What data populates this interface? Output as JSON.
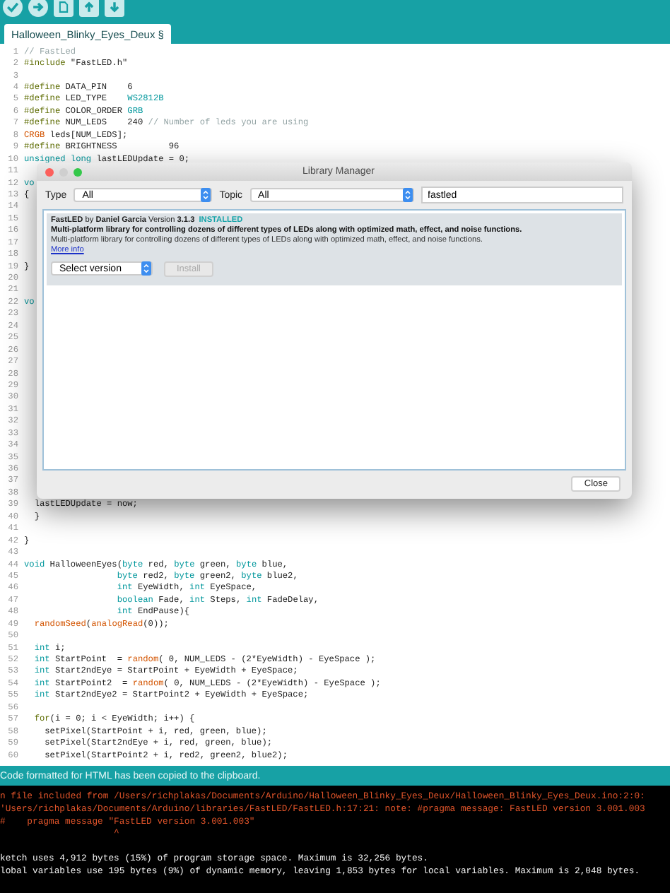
{
  "toolbar": {
    "buttons": [
      {
        "kind": "verify"
      },
      {
        "kind": "upload"
      },
      {
        "kind": "new"
      },
      {
        "kind": "open"
      },
      {
        "kind": "save"
      }
    ]
  },
  "tabs": [
    {
      "label": "Halloween_Blinky_Eyes_Deux §",
      "selected": true
    }
  ],
  "editor": {
    "lines": [
      {
        "number": "1",
        "segments": [
          {
            "text": "// FastLed",
            "kind": "comment"
          }
        ]
      },
      {
        "number": "2",
        "segments": [
          {
            "text": "#include",
            "kind": "directive"
          },
          {
            "text": " \"FastLED.h\"",
            "kind": "plain"
          }
        ]
      },
      {
        "number": "3"
      },
      {
        "number": "4",
        "segments": [
          {
            "text": "#define",
            "kind": "directive"
          },
          {
            "text": " DATA_PIN    6",
            "kind": "plain"
          }
        ]
      },
      {
        "number": "5",
        "segments": [
          {
            "text": "#define",
            "kind": "directive"
          },
          {
            "text": " LED_TYPE    ",
            "kind": "plain"
          },
          {
            "text": "WS2812B",
            "kind": "keyword"
          }
        ]
      },
      {
        "number": "6",
        "segments": [
          {
            "text": "#define",
            "kind": "directive"
          },
          {
            "text": " COLOR_ORDER ",
            "kind": "plain"
          },
          {
            "text": "GRB",
            "kind": "keyword"
          }
        ]
      },
      {
        "number": "7",
        "segments": [
          {
            "text": "#define",
            "kind": "directive"
          },
          {
            "text": " NUM_LEDS    240 ",
            "kind": "plain"
          },
          {
            "text": "// Number of leds you are using",
            "kind": "comment"
          }
        ]
      },
      {
        "number": "8",
        "segments": [
          {
            "text": "CRGB",
            "kind": "function"
          },
          {
            "text": " leds[NUM_LEDS];",
            "kind": "plain"
          }
        ]
      },
      {
        "number": "9",
        "segments": [
          {
            "text": "#define",
            "kind": "directive"
          },
          {
            "text": " BRIGHTNESS          96",
            "kind": "plain"
          }
        ]
      },
      {
        "number": "10",
        "segments": [
          {
            "text": "unsigned long",
            "kind": "keyword"
          },
          {
            "text": " lastLEDUpdate = 0;",
            "kind": "plain"
          }
        ]
      },
      {
        "number": "11"
      },
      {
        "number": "12",
        "segments": [
          {
            "text": "vo",
            "kind": "keyword"
          }
        ]
      },
      {
        "number": "13",
        "segments": [
          {
            "text": "{",
            "kind": "plain"
          }
        ]
      },
      {
        "number": "14"
      },
      {
        "number": "15"
      },
      {
        "number": "16"
      },
      {
        "number": "17"
      },
      {
        "number": "18"
      },
      {
        "number": "19",
        "segments": [
          {
            "text": "}",
            "kind": "plain"
          }
        ]
      },
      {
        "number": "20"
      },
      {
        "number": "21"
      },
      {
        "number": "22",
        "segments": [
          {
            "text": "vo",
            "kind": "keyword"
          }
        ]
      },
      {
        "number": "23"
      },
      {
        "number": "24"
      },
      {
        "number": "25"
      },
      {
        "number": "26"
      },
      {
        "number": "27"
      },
      {
        "number": "28"
      },
      {
        "number": "29"
      },
      {
        "number": "30"
      },
      {
        "number": "31"
      },
      {
        "number": "32"
      },
      {
        "number": "33"
      },
      {
        "number": "34"
      },
      {
        "number": "35"
      },
      {
        "number": "36"
      },
      {
        "number": "37"
      },
      {
        "number": "38"
      },
      {
        "number": "39",
        "segments": [
          {
            "text": "  lastLEDUpdate = now;",
            "kind": "plain"
          }
        ]
      },
      {
        "number": "40",
        "segments": [
          {
            "text": "  }",
            "kind": "plain"
          }
        ]
      },
      {
        "number": "41"
      },
      {
        "number": "42",
        "segments": [
          {
            "text": "}",
            "kind": "plain"
          }
        ]
      },
      {
        "number": "43"
      },
      {
        "number": "44",
        "segments": [
          {
            "text": "void",
            "kind": "keyword"
          },
          {
            "text": " HalloweenEyes(",
            "kind": "plain"
          },
          {
            "text": "byte",
            "kind": "keyword"
          },
          {
            "text": " red, ",
            "kind": "plain"
          },
          {
            "text": "byte",
            "kind": "keyword"
          },
          {
            "text": " green, ",
            "kind": "plain"
          },
          {
            "text": "byte",
            "kind": "keyword"
          },
          {
            "text": " blue,",
            "kind": "plain"
          }
        ]
      },
      {
        "number": "45",
        "segments": [
          {
            "text": "                  byte",
            "kind": "keyword"
          },
          {
            "text": " red2, ",
            "kind": "plain"
          },
          {
            "text": "byte",
            "kind": "keyword"
          },
          {
            "text": " green2, ",
            "kind": "plain"
          },
          {
            "text": "byte",
            "kind": "keyword"
          },
          {
            "text": " blue2,",
            "kind": "plain"
          }
        ]
      },
      {
        "number": "46",
        "segments": [
          {
            "text": "                  int",
            "kind": "keyword"
          },
          {
            "text": " EyeWidth, ",
            "kind": "plain"
          },
          {
            "text": "int",
            "kind": "keyword"
          },
          {
            "text": " EyeSpace,",
            "kind": "plain"
          }
        ]
      },
      {
        "number": "47",
        "segments": [
          {
            "text": "                  boolean",
            "kind": "keyword"
          },
          {
            "text": " Fade, ",
            "kind": "plain"
          },
          {
            "text": "int",
            "kind": "keyword"
          },
          {
            "text": " Steps, ",
            "kind": "plain"
          },
          {
            "text": "int",
            "kind": "keyword"
          },
          {
            "text": " FadeDelay,",
            "kind": "plain"
          }
        ]
      },
      {
        "number": "48",
        "segments": [
          {
            "text": "                  int",
            "kind": "keyword"
          },
          {
            "text": " EndPause){",
            "kind": "plain"
          }
        ]
      },
      {
        "number": "49",
        "segments": [
          {
            "text": "  randomSeed",
            "kind": "function"
          },
          {
            "text": "(",
            "kind": "plain"
          },
          {
            "text": "analogRead",
            "kind": "function"
          },
          {
            "text": "(0));",
            "kind": "plain"
          }
        ]
      },
      {
        "number": "50"
      },
      {
        "number": "51",
        "segments": [
          {
            "text": "  int",
            "kind": "keyword"
          },
          {
            "text": " i;",
            "kind": "plain"
          }
        ]
      },
      {
        "number": "52",
        "segments": [
          {
            "text": "  int",
            "kind": "keyword"
          },
          {
            "text": " StartPoint  = ",
            "kind": "plain"
          },
          {
            "text": "random",
            "kind": "function"
          },
          {
            "text": "( 0, NUM_LEDS - (2*EyeWidth) - EyeSpace );",
            "kind": "plain"
          }
        ]
      },
      {
        "number": "53",
        "segments": [
          {
            "text": "  int",
            "kind": "keyword"
          },
          {
            "text": " Start2ndEye = StartPoint + EyeWidth + EyeSpace;",
            "kind": "plain"
          }
        ]
      },
      {
        "number": "54",
        "segments": [
          {
            "text": "  int",
            "kind": "keyword"
          },
          {
            "text": " StartPoint2  = ",
            "kind": "plain"
          },
          {
            "text": "random",
            "kind": "function"
          },
          {
            "text": "( 0, NUM_LEDS - (2*EyeWidth) - EyeSpace );",
            "kind": "plain"
          }
        ]
      },
      {
        "number": "55",
        "segments": [
          {
            "text": "  int",
            "kind": "keyword"
          },
          {
            "text": " Start2ndEye2 = StartPoint2 + EyeWidth + EyeSpace;",
            "kind": "plain"
          }
        ]
      },
      {
        "number": "56"
      },
      {
        "number": "57",
        "segments": [
          {
            "text": "  for",
            "kind": "directive"
          },
          {
            "text": "(i = 0; i < EyeWidth; i++) {",
            "kind": "plain"
          }
        ]
      },
      {
        "number": "58",
        "segments": [
          {
            "text": "    setPixel(StartPoint + i, red, green, blue);",
            "kind": "plain"
          }
        ]
      },
      {
        "number": "59",
        "segments": [
          {
            "text": "    setPixel(Start2ndEye + i, red, green, blue);",
            "kind": "plain"
          }
        ]
      },
      {
        "number": "60",
        "segments": [
          {
            "text": "    setPixel(StartPoint2 + i, red2, green2, blue2);",
            "kind": "plain"
          }
        ]
      }
    ]
  },
  "dialog": {
    "title": "Library Manager",
    "filters": {
      "type_label": "Type",
      "type_value": "All",
      "topic_label": "Topic",
      "topic_value": "All",
      "search_value": "fastled"
    },
    "libraries": [
      {
        "header": "**FastLED** by **Daniel Garcia** Version **3.1.3**",
        "status": "INSTALLED",
        "summary": "Multi-platform library for controlling dozens of different types of LEDs along with optimized math, effect, and noise functions.",
        "description": "Multi-platform library for controlling dozens of different types of LEDs along with optimized math, effect, and noise functions.",
        "link": "More info",
        "version_select": "Select version",
        "install_button": "Install",
        "install_disabled": true,
        "selected": true
      }
    ],
    "close_button": "Close"
  },
  "status_bar": "Code formatted for HTML has been copied to the clipboard.",
  "console": [
    {
      "text": "n file included from /Users/richplakas/Documents/Arduino/Halloween_Blinky_Eyes_Deux/Halloween_Blinky_Eyes_Deux.ino:2:0:",
      "kind": "error"
    },
    {
      "text": "'Users/richplakas/Documents/Arduino/libraries/FastLED/FastLED.h:17:21: note: #pragma message: FastLED version 3.001.003",
      "kind": "error"
    },
    {
      "text": "#    pragma message \"FastLED version 3.001.003\"",
      "kind": "error"
    },
    {
      "text": "                     ^",
      "kind": "error"
    },
    {
      "kind": "blank"
    },
    {
      "text": "ketch uses 4,912 bytes (15%) of program storage space. Maximum is 32,256 bytes.",
      "kind": "info"
    },
    {
      "text": "lobal variables use 195 bytes (9%) of dynamic memory, leaving 1,853 bytes for local variables. Maximum is 2,048 bytes.",
      "kind": "info"
    }
  ]
}
